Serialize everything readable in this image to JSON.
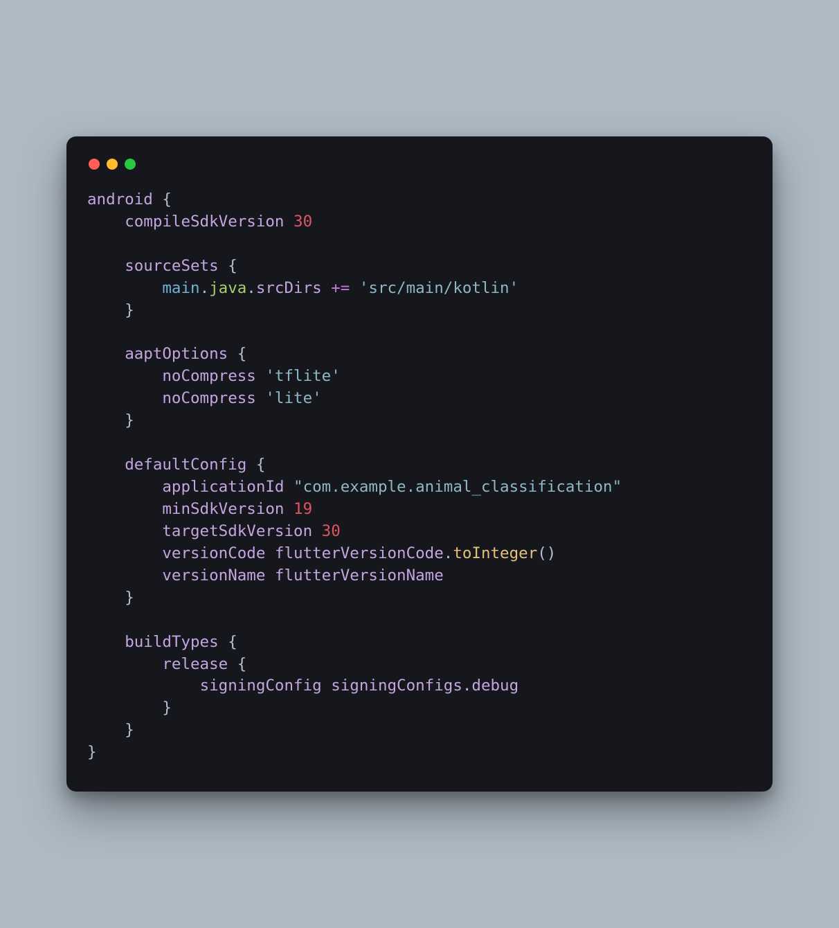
{
  "code": {
    "android": "android",
    "compileSdkVersion": "compileSdkVersion",
    "compileSdkVersion_val": "30",
    "sourceSets": "sourceSets",
    "main": "main",
    "java": "java",
    "srcDirs": "srcDirs",
    "plusEq": "+=",
    "srcDirs_val": "'src/main/kotlin'",
    "aaptOptions": "aaptOptions",
    "noCompress": "noCompress",
    "noCompress_val1": "'tflite'",
    "noCompress_val2": "'lite'",
    "defaultConfig": "defaultConfig",
    "applicationId": "applicationId",
    "applicationId_val": "\"com.example.animal_classification\"",
    "minSdkVersion": "minSdkVersion",
    "minSdkVersion_val": "19",
    "targetSdkVersion": "targetSdkVersion",
    "targetSdkVersion_val": "30",
    "versionCode": "versionCode",
    "flutterVersionCode": "flutterVersionCode",
    "toInteger": "toInteger",
    "versionName": "versionName",
    "flutterVersionName": "flutterVersionName",
    "buildTypes": "buildTypes",
    "release": "release",
    "signingConfig": "signingConfig",
    "signingConfigs": "signingConfigs",
    "debug": "debug",
    "dot": ".",
    "lbrace": "{",
    "rbrace": "}",
    "lparen": "(",
    "rparen": ")"
  }
}
